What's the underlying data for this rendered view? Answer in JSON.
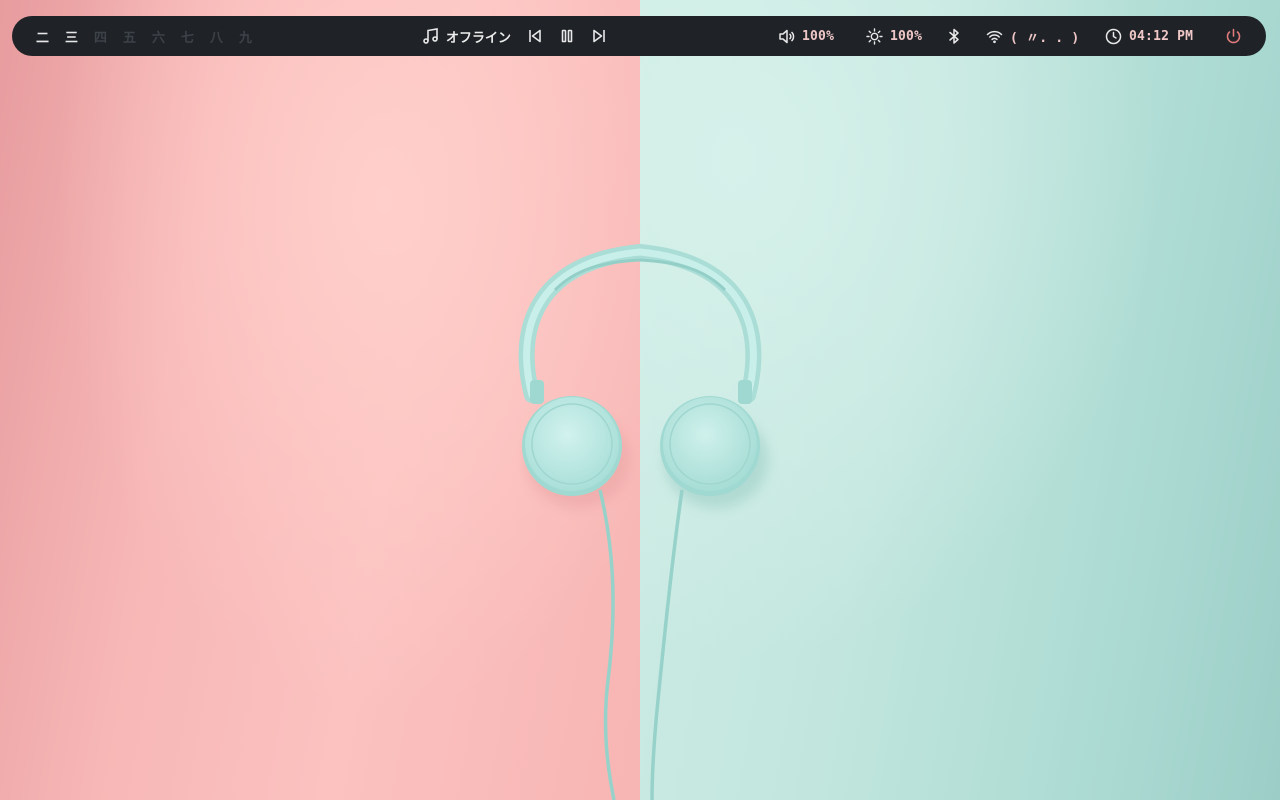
{
  "topbar": {
    "workspaces": [
      {
        "label": "二",
        "active": true
      },
      {
        "label": "三",
        "active": true
      },
      {
        "label": "四",
        "active": false
      },
      {
        "label": "五",
        "active": false
      },
      {
        "label": "六",
        "active": false
      },
      {
        "label": "七",
        "active": false
      },
      {
        "label": "八",
        "active": false
      },
      {
        "label": "九",
        "active": false
      }
    ],
    "media": {
      "icon": "music-note-icon",
      "track": "オフライン",
      "controls": [
        "previous-icon",
        "pause-icon",
        "next-icon"
      ]
    },
    "volume": {
      "icon": "speaker-icon",
      "value": "100%"
    },
    "brightness": {
      "icon": "sun-icon",
      "value": "100%"
    },
    "bluetooth": {
      "icon": "bluetooth-icon"
    },
    "network": {
      "icon": "wifi-icon",
      "value": "( 〃. . )"
    },
    "clock": {
      "icon": "clock-icon",
      "value": "04:12 PM"
    },
    "power": {
      "icon": "power-icon"
    }
  },
  "colors": {
    "bar_bg": "#1f2328",
    "text": "#e8e8e8",
    "value_text": "#f0c7c7",
    "inactive_workspace": "#3d4248",
    "power_accent": "#e07a7a",
    "wall_left": "#f7b7b6",
    "wall_right": "#c2e6de",
    "headphones": "#b9e8e2"
  }
}
